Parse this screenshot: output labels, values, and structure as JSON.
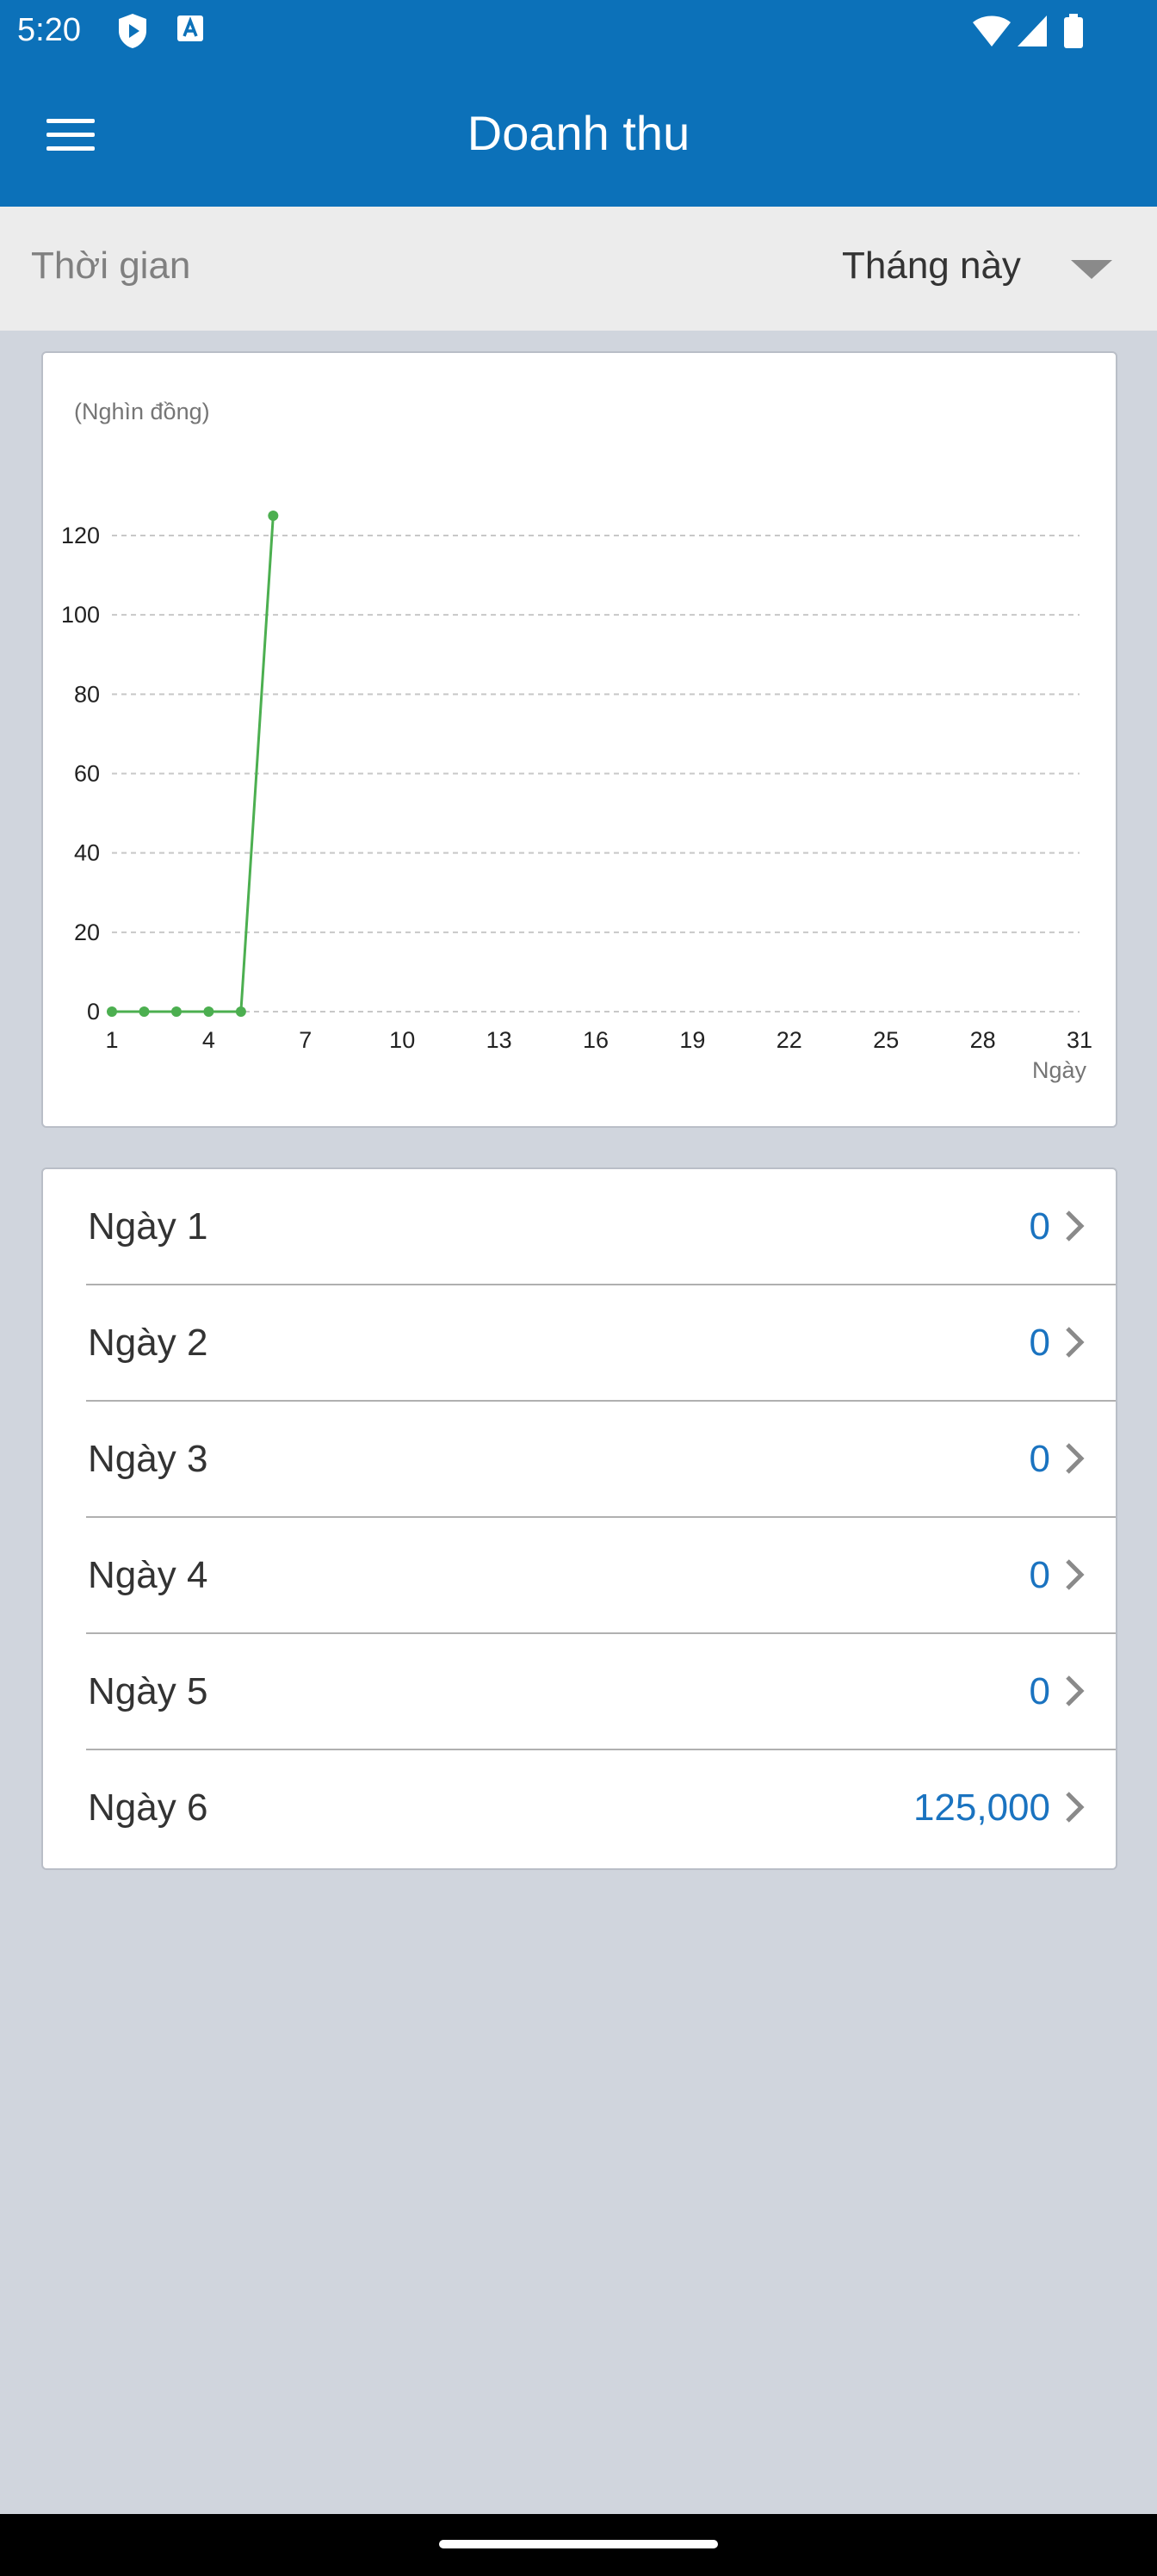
{
  "status_bar": {
    "time": "5:20",
    "left_icons": [
      "shield-play-icon",
      "translate-a-icon"
    ],
    "right_icons": [
      "wifi-icon",
      "signal-icon",
      "battery-icon"
    ]
  },
  "header": {
    "title": "Doanh thu",
    "menu_icon": "hamburger-menu-icon"
  },
  "filter": {
    "label": "Thời gian",
    "selected": "Tháng này"
  },
  "chart_data": {
    "type": "line",
    "title": "",
    "ylabel": "(Nghìn đồng)",
    "xlabel": "Ngày",
    "x_ticks": [
      1,
      4,
      7,
      10,
      13,
      16,
      19,
      22,
      25,
      28,
      31
    ],
    "y_ticks": [
      0,
      20,
      40,
      60,
      80,
      100,
      120
    ],
    "xlim": [
      1,
      31
    ],
    "ylim": [
      0,
      120
    ],
    "grid": true,
    "color": "#4caf50",
    "x": [
      1,
      2,
      3,
      4,
      5,
      6
    ],
    "values": [
      0,
      0,
      0,
      0,
      0,
      125
    ]
  },
  "list": {
    "items": [
      {
        "label": "Ngày 1",
        "value": "0"
      },
      {
        "label": "Ngày 2",
        "value": "0"
      },
      {
        "label": "Ngày 3",
        "value": "0"
      },
      {
        "label": "Ngày 4",
        "value": "0"
      },
      {
        "label": "Ngày 5",
        "value": "0"
      },
      {
        "label": "Ngày 6",
        "value": "125,000"
      }
    ]
  },
  "colors": {
    "primary": "#0c71b9",
    "value_blue": "#1a73c0",
    "background": "#d0d5dd"
  }
}
